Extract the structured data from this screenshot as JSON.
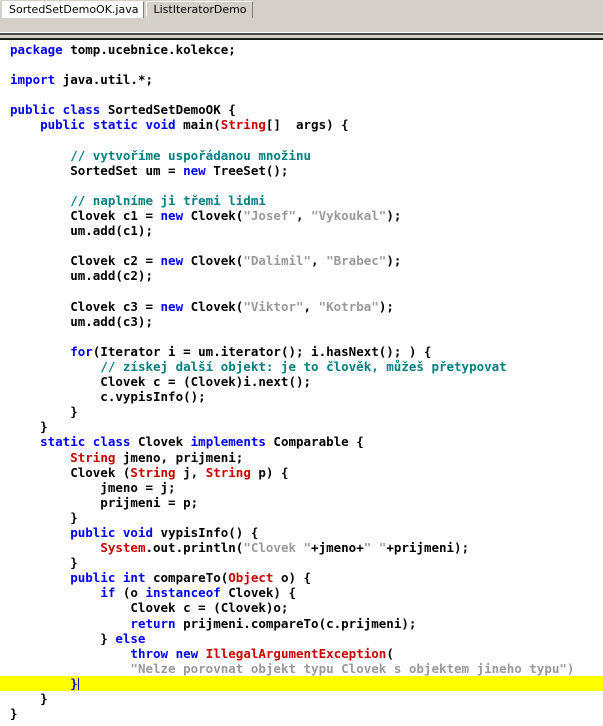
{
  "window": {
    "title": "SortedSetDemoOK.java"
  },
  "tabs": [
    {
      "label": "SortedSetDemoOK.java",
      "active": true
    },
    {
      "label": "ListIteratorDemo",
      "active": false
    }
  ],
  "colors": {
    "keyword": "#0000ff",
    "type": "#cc0000",
    "comment": "#008080",
    "string": "#999999",
    "plain": "#000000",
    "highlight": "#ffff00",
    "chrome": "#d4d0c8",
    "background": "#ffffff"
  },
  "editor": {
    "language": "Java",
    "highlighted_line_index": 43,
    "caret_line_text": "        }",
    "lines": [
      {
        "tokens": [
          {
            "t": "package",
            "c": "kw"
          },
          {
            "t": " tomp.ucebnice.kolekce;",
            "c": "pln"
          }
        ]
      },
      {
        "tokens": []
      },
      {
        "tokens": [
          {
            "t": "import",
            "c": "kw"
          },
          {
            "t": " java.util.*;",
            "c": "pln"
          }
        ]
      },
      {
        "tokens": []
      },
      {
        "tokens": [
          {
            "t": "public class",
            "c": "kw"
          },
          {
            "t": " SortedSetDemoOK {",
            "c": "pln"
          }
        ]
      },
      {
        "tokens": [
          {
            "t": "    ",
            "c": "pln"
          },
          {
            "t": "public static void",
            "c": "kw"
          },
          {
            "t": " main(",
            "c": "pln"
          },
          {
            "t": "String",
            "c": "typ"
          },
          {
            "t": "[]  args) {",
            "c": "pln"
          }
        ]
      },
      {
        "tokens": []
      },
      {
        "tokens": [
          {
            "t": "        ",
            "c": "pln"
          },
          {
            "t": "// vytvoříme uspořádanou množinu",
            "c": "cmt"
          }
        ]
      },
      {
        "tokens": [
          {
            "t": "        SortedSet um = ",
            "c": "pln"
          },
          {
            "t": "new",
            "c": "kw"
          },
          {
            "t": " TreeSet();",
            "c": "pln"
          }
        ]
      },
      {
        "tokens": []
      },
      {
        "tokens": [
          {
            "t": "        ",
            "c": "pln"
          },
          {
            "t": "// naplníme ji třemi lidmi",
            "c": "cmt"
          }
        ]
      },
      {
        "tokens": [
          {
            "t": "        Clovek c1 = ",
            "c": "pln"
          },
          {
            "t": "new",
            "c": "kw"
          },
          {
            "t": " Clovek(",
            "c": "pln"
          },
          {
            "t": "\"Josef\"",
            "c": "str"
          },
          {
            "t": ", ",
            "c": "pln"
          },
          {
            "t": "\"Vykoukal\"",
            "c": "str"
          },
          {
            "t": ");",
            "c": "pln"
          }
        ]
      },
      {
        "tokens": [
          {
            "t": "        um.add(c1);",
            "c": "pln"
          }
        ]
      },
      {
        "tokens": []
      },
      {
        "tokens": [
          {
            "t": "        Clovek c2 = ",
            "c": "pln"
          },
          {
            "t": "new",
            "c": "kw"
          },
          {
            "t": " Clovek(",
            "c": "pln"
          },
          {
            "t": "\"Dalimil\"",
            "c": "str"
          },
          {
            "t": ", ",
            "c": "pln"
          },
          {
            "t": "\"Brabec\"",
            "c": "str"
          },
          {
            "t": ");",
            "c": "pln"
          }
        ]
      },
      {
        "tokens": [
          {
            "t": "        um.add(c2);",
            "c": "pln"
          }
        ]
      },
      {
        "tokens": []
      },
      {
        "tokens": [
          {
            "t": "        Clovek c3 = ",
            "c": "pln"
          },
          {
            "t": "new",
            "c": "kw"
          },
          {
            "t": " Clovek(",
            "c": "pln"
          },
          {
            "t": "\"Viktor\"",
            "c": "str"
          },
          {
            "t": ", ",
            "c": "pln"
          },
          {
            "t": "\"Kotrba\"",
            "c": "str"
          },
          {
            "t": ");",
            "c": "pln"
          }
        ]
      },
      {
        "tokens": [
          {
            "t": "        um.add(c3);",
            "c": "pln"
          }
        ]
      },
      {
        "tokens": []
      },
      {
        "tokens": [
          {
            "t": "        ",
            "c": "pln"
          },
          {
            "t": "for",
            "c": "kw"
          },
          {
            "t": "(Iterator i = um.iterator(); i.hasNext(); ) {",
            "c": "pln"
          }
        ]
      },
      {
        "tokens": [
          {
            "t": "            ",
            "c": "pln"
          },
          {
            "t": "// získej další objekt: je to člověk, můžeš přetypovat",
            "c": "cmt"
          }
        ]
      },
      {
        "tokens": [
          {
            "t": "            Clovek c = (Clovek)i.next();",
            "c": "pln"
          }
        ]
      },
      {
        "tokens": [
          {
            "t": "            c.vypisInfo();",
            "c": "pln"
          }
        ]
      },
      {
        "tokens": [
          {
            "t": "        }",
            "c": "pln"
          }
        ]
      },
      {
        "tokens": [
          {
            "t": "    }",
            "c": "pln"
          }
        ]
      },
      {
        "tokens": [
          {
            "t": "    ",
            "c": "pln"
          },
          {
            "t": "static class",
            "c": "kw"
          },
          {
            "t": " Clovek ",
            "c": "pln"
          },
          {
            "t": "implements",
            "c": "kw"
          },
          {
            "t": " Comparable {",
            "c": "pln"
          }
        ]
      },
      {
        "tokens": [
          {
            "t": "        ",
            "c": "pln"
          },
          {
            "t": "String",
            "c": "typ"
          },
          {
            "t": " jmeno, prijmeni;",
            "c": "pln"
          }
        ]
      },
      {
        "tokens": [
          {
            "t": "        Clovek (",
            "c": "pln"
          },
          {
            "t": "String",
            "c": "typ"
          },
          {
            "t": " j, ",
            "c": "pln"
          },
          {
            "t": "String",
            "c": "typ"
          },
          {
            "t": " p) {",
            "c": "pln"
          }
        ]
      },
      {
        "tokens": [
          {
            "t": "            jmeno = j;",
            "c": "pln"
          }
        ]
      },
      {
        "tokens": [
          {
            "t": "            prijmeni = p;",
            "c": "pln"
          }
        ]
      },
      {
        "tokens": [
          {
            "t": "        }",
            "c": "pln"
          }
        ]
      },
      {
        "tokens": [
          {
            "t": "        ",
            "c": "pln"
          },
          {
            "t": "public void",
            "c": "kw"
          },
          {
            "t": " vypisInfo() {",
            "c": "pln"
          }
        ]
      },
      {
        "tokens": [
          {
            "t": "            ",
            "c": "pln"
          },
          {
            "t": "System",
            "c": "typ"
          },
          {
            "t": ".out.println(",
            "c": "pln"
          },
          {
            "t": "\"Clovek \"",
            "c": "str"
          },
          {
            "t": "+jmeno+",
            "c": "pln"
          },
          {
            "t": "\" \"",
            "c": "str"
          },
          {
            "t": "+prijmeni);",
            "c": "pln"
          }
        ]
      },
      {
        "tokens": [
          {
            "t": "        }",
            "c": "pln"
          }
        ]
      },
      {
        "tokens": [
          {
            "t": "        ",
            "c": "pln"
          },
          {
            "t": "public int",
            "c": "kw"
          },
          {
            "t": " compareTo(",
            "c": "pln"
          },
          {
            "t": "Object",
            "c": "typ"
          },
          {
            "t": " o) {",
            "c": "pln"
          }
        ]
      },
      {
        "tokens": [
          {
            "t": "            ",
            "c": "pln"
          },
          {
            "t": "if",
            "c": "kw"
          },
          {
            "t": " (o ",
            "c": "pln"
          },
          {
            "t": "instanceof",
            "c": "kw"
          },
          {
            "t": " Clovek) {",
            "c": "pln"
          }
        ]
      },
      {
        "tokens": [
          {
            "t": "                Clovek c = (Clovek)o;",
            "c": "pln"
          }
        ]
      },
      {
        "tokens": [
          {
            "t": "                ",
            "c": "pln"
          },
          {
            "t": "return",
            "c": "kw"
          },
          {
            "t": " prijmeni.compareTo(c.prijmeni);",
            "c": "pln"
          }
        ]
      },
      {
        "tokens": [
          {
            "t": "            } ",
            "c": "pln"
          },
          {
            "t": "else",
            "c": "kw"
          }
        ]
      },
      {
        "tokens": [
          {
            "t": "                ",
            "c": "pln"
          },
          {
            "t": "throw new",
            "c": "kw"
          },
          {
            "t": " ",
            "c": "pln"
          },
          {
            "t": "IllegalArgumentException",
            "c": "typ"
          },
          {
            "t": "(",
            "c": "pln"
          }
        ]
      },
      {
        "tokens": [
          {
            "t": "                ",
            "c": "pln"
          },
          {
            "t": "\"Nelze porovnat objekt typu Clovek s objektem jineho typu\")",
            "c": "str"
          }
        ]
      },
      {
        "tokens": [
          {
            "t": "        }",
            "c": "kw"
          }
        ],
        "highlight": true,
        "caret": true
      },
      {
        "tokens": [
          {
            "t": "    }",
            "c": "pln"
          }
        ]
      },
      {
        "tokens": [
          {
            "t": "}",
            "c": "pln"
          }
        ]
      }
    ]
  }
}
